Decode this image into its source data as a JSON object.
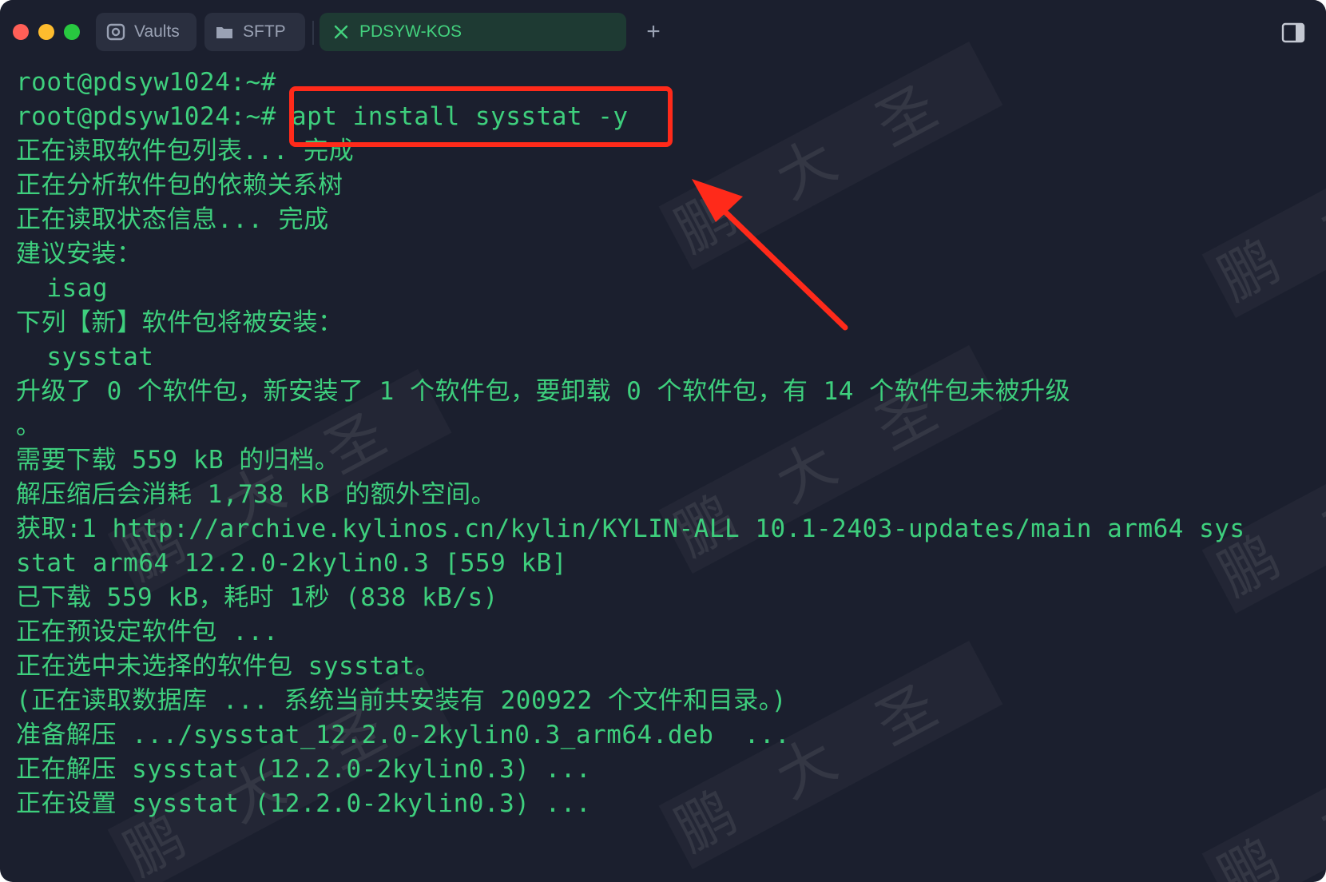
{
  "tabs": [
    {
      "label": "Vaults",
      "icon": "vault-icon"
    },
    {
      "label": "SFTP",
      "icon": "folder-icon"
    },
    {
      "label": "PDSYW-KOS",
      "icon": "close-icon",
      "active": true
    }
  ],
  "new_tab_label": "+",
  "watermark_text": "鹏大圣",
  "terminal": {
    "lines": [
      "root@pdsyw1024:~#",
      "root@pdsyw1024:~# apt install sysstat -y",
      "正在读取软件包列表... 完成",
      "正在分析软件包的依赖关系树",
      "正在读取状态信息... 完成",
      "建议安装：",
      "  isag",
      "下列【新】软件包将被安装：",
      "  sysstat",
      "升级了 0 个软件包，新安装了 1 个软件包，要卸载 0 个软件包，有 14 个软件包未被升级",
      "。",
      "需要下载 559 kB 的归档。",
      "解压缩后会消耗 1,738 kB 的额外空间。",
      "获取:1 http://archive.kylinos.cn/kylin/KYLIN-ALL 10.1-2403-updates/main arm64 sys",
      "stat arm64 12.2.0-2kylin0.3 [559 kB]",
      "已下载 559 kB，耗时 1秒 (838 kB/s)",
      "正在预设定软件包 ...",
      "正在选中未选择的软件包 sysstat。",
      "(正在读取数据库 ... 系统当前共安装有 200922 个文件和目录。)",
      "准备解压 .../sysstat_12.2.0-2kylin0.3_arm64.deb  ...",
      "正在解压 sysstat (12.2.0-2kylin0.3) ...",
      "正在设置 sysstat (12.2.0-2kylin0.3) ..."
    ]
  },
  "colors": {
    "background": "#1b1f2e",
    "text": "#3ecf7d",
    "active_tab": "#1e3a33",
    "annotation": "#ff2a1a"
  }
}
